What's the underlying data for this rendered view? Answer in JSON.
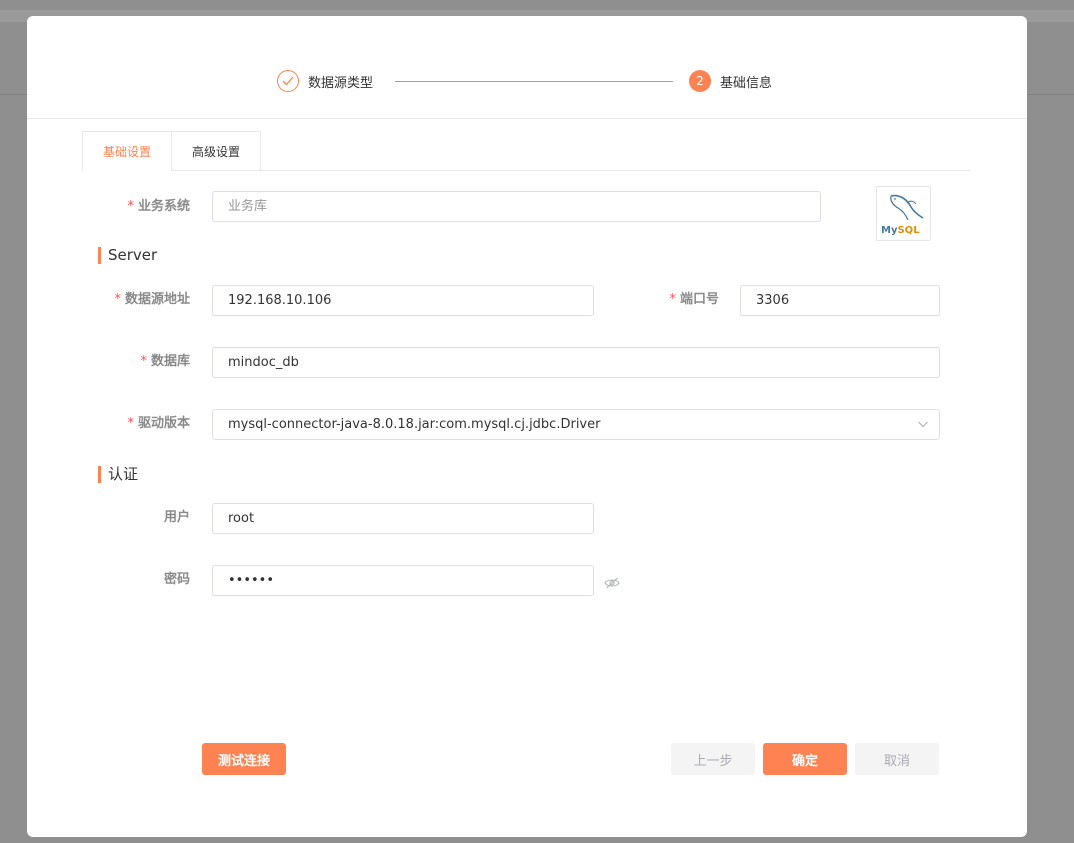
{
  "steps": [
    {
      "title": "数据源类型",
      "state": "done"
    },
    {
      "title": "基础信息",
      "number": "2",
      "state": "active"
    }
  ],
  "tabs": [
    {
      "label": "基础设置",
      "active": true
    },
    {
      "label": "高级设置",
      "active": false
    }
  ],
  "form": {
    "required_mark": "*",
    "business_system": {
      "label": "业务系统",
      "placeholder": "业务库",
      "value": ""
    },
    "server_section": "Server",
    "host": {
      "label": "数据源地址",
      "value": "192.168.10.106"
    },
    "port": {
      "label": "端口号",
      "value": "3306"
    },
    "database": {
      "label": "数据库",
      "value": "mindoc_db"
    },
    "driver": {
      "label": "驱动版本",
      "value": "mysql-connector-java-8.0.18.jar:com.mysql.cj.jdbc.Driver"
    },
    "auth_section": "认证",
    "user": {
      "label": "用户",
      "value": "root"
    },
    "password": {
      "label": "密码",
      "value": "••••••"
    }
  },
  "logo": {
    "part1": "My",
    "part2": "SQL",
    "color_my": "#4479a1",
    "color_sql": "#e48e00"
  },
  "icons": {
    "step_done": "check-icon",
    "select": "chevron-down-icon",
    "password_toggle": "eye-off-icon",
    "logo": "mysql-dolphin-icon"
  },
  "buttons": {
    "test": "测试连接",
    "prev": "上一步",
    "ok": "确定",
    "cancel": "取消"
  },
  "colors": {
    "accent": "#ff8252",
    "required": "#ff4d4f",
    "label": "#8a8a8a",
    "border": "#dcdfe6"
  }
}
